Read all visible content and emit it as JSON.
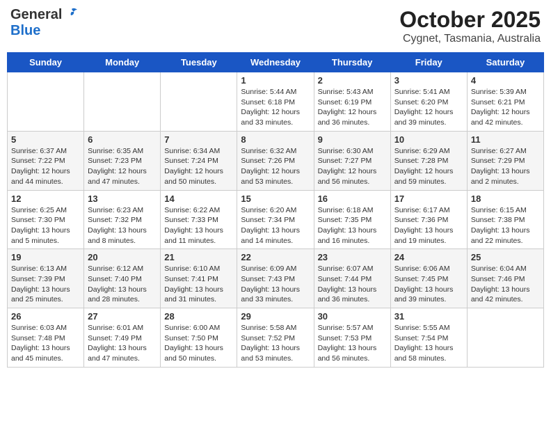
{
  "header": {
    "logo_general": "General",
    "logo_blue": "Blue",
    "month": "October 2025",
    "location": "Cygnet, Tasmania, Australia"
  },
  "days_of_week": [
    "Sunday",
    "Monday",
    "Tuesday",
    "Wednesday",
    "Thursday",
    "Friday",
    "Saturday"
  ],
  "weeks": [
    [
      {
        "day": "",
        "info": ""
      },
      {
        "day": "",
        "info": ""
      },
      {
        "day": "",
        "info": ""
      },
      {
        "day": "1",
        "info": "Sunrise: 5:44 AM\nSunset: 6:18 PM\nDaylight: 12 hours\nand 33 minutes."
      },
      {
        "day": "2",
        "info": "Sunrise: 5:43 AM\nSunset: 6:19 PM\nDaylight: 12 hours\nand 36 minutes."
      },
      {
        "day": "3",
        "info": "Sunrise: 5:41 AM\nSunset: 6:20 PM\nDaylight: 12 hours\nand 39 minutes."
      },
      {
        "day": "4",
        "info": "Sunrise: 5:39 AM\nSunset: 6:21 PM\nDaylight: 12 hours\nand 42 minutes."
      }
    ],
    [
      {
        "day": "5",
        "info": "Sunrise: 6:37 AM\nSunset: 7:22 PM\nDaylight: 12 hours\nand 44 minutes."
      },
      {
        "day": "6",
        "info": "Sunrise: 6:35 AM\nSunset: 7:23 PM\nDaylight: 12 hours\nand 47 minutes."
      },
      {
        "day": "7",
        "info": "Sunrise: 6:34 AM\nSunset: 7:24 PM\nDaylight: 12 hours\nand 50 minutes."
      },
      {
        "day": "8",
        "info": "Sunrise: 6:32 AM\nSunset: 7:26 PM\nDaylight: 12 hours\nand 53 minutes."
      },
      {
        "day": "9",
        "info": "Sunrise: 6:30 AM\nSunset: 7:27 PM\nDaylight: 12 hours\nand 56 minutes."
      },
      {
        "day": "10",
        "info": "Sunrise: 6:29 AM\nSunset: 7:28 PM\nDaylight: 12 hours\nand 59 minutes."
      },
      {
        "day": "11",
        "info": "Sunrise: 6:27 AM\nSunset: 7:29 PM\nDaylight: 13 hours\nand 2 minutes."
      }
    ],
    [
      {
        "day": "12",
        "info": "Sunrise: 6:25 AM\nSunset: 7:30 PM\nDaylight: 13 hours\nand 5 minutes."
      },
      {
        "day": "13",
        "info": "Sunrise: 6:23 AM\nSunset: 7:32 PM\nDaylight: 13 hours\nand 8 minutes."
      },
      {
        "day": "14",
        "info": "Sunrise: 6:22 AM\nSunset: 7:33 PM\nDaylight: 13 hours\nand 11 minutes."
      },
      {
        "day": "15",
        "info": "Sunrise: 6:20 AM\nSunset: 7:34 PM\nDaylight: 13 hours\nand 14 minutes."
      },
      {
        "day": "16",
        "info": "Sunrise: 6:18 AM\nSunset: 7:35 PM\nDaylight: 13 hours\nand 16 minutes."
      },
      {
        "day": "17",
        "info": "Sunrise: 6:17 AM\nSunset: 7:36 PM\nDaylight: 13 hours\nand 19 minutes."
      },
      {
        "day": "18",
        "info": "Sunrise: 6:15 AM\nSunset: 7:38 PM\nDaylight: 13 hours\nand 22 minutes."
      }
    ],
    [
      {
        "day": "19",
        "info": "Sunrise: 6:13 AM\nSunset: 7:39 PM\nDaylight: 13 hours\nand 25 minutes."
      },
      {
        "day": "20",
        "info": "Sunrise: 6:12 AM\nSunset: 7:40 PM\nDaylight: 13 hours\nand 28 minutes."
      },
      {
        "day": "21",
        "info": "Sunrise: 6:10 AM\nSunset: 7:41 PM\nDaylight: 13 hours\nand 31 minutes."
      },
      {
        "day": "22",
        "info": "Sunrise: 6:09 AM\nSunset: 7:43 PM\nDaylight: 13 hours\nand 33 minutes."
      },
      {
        "day": "23",
        "info": "Sunrise: 6:07 AM\nSunset: 7:44 PM\nDaylight: 13 hours\nand 36 minutes."
      },
      {
        "day": "24",
        "info": "Sunrise: 6:06 AM\nSunset: 7:45 PM\nDaylight: 13 hours\nand 39 minutes."
      },
      {
        "day": "25",
        "info": "Sunrise: 6:04 AM\nSunset: 7:46 PM\nDaylight: 13 hours\nand 42 minutes."
      }
    ],
    [
      {
        "day": "26",
        "info": "Sunrise: 6:03 AM\nSunset: 7:48 PM\nDaylight: 13 hours\nand 45 minutes."
      },
      {
        "day": "27",
        "info": "Sunrise: 6:01 AM\nSunset: 7:49 PM\nDaylight: 13 hours\nand 47 minutes."
      },
      {
        "day": "28",
        "info": "Sunrise: 6:00 AM\nSunset: 7:50 PM\nDaylight: 13 hours\nand 50 minutes."
      },
      {
        "day": "29",
        "info": "Sunrise: 5:58 AM\nSunset: 7:52 PM\nDaylight: 13 hours\nand 53 minutes."
      },
      {
        "day": "30",
        "info": "Sunrise: 5:57 AM\nSunset: 7:53 PM\nDaylight: 13 hours\nand 56 minutes."
      },
      {
        "day": "31",
        "info": "Sunrise: 5:55 AM\nSunset: 7:54 PM\nDaylight: 13 hours\nand 58 minutes."
      },
      {
        "day": "",
        "info": ""
      }
    ]
  ]
}
